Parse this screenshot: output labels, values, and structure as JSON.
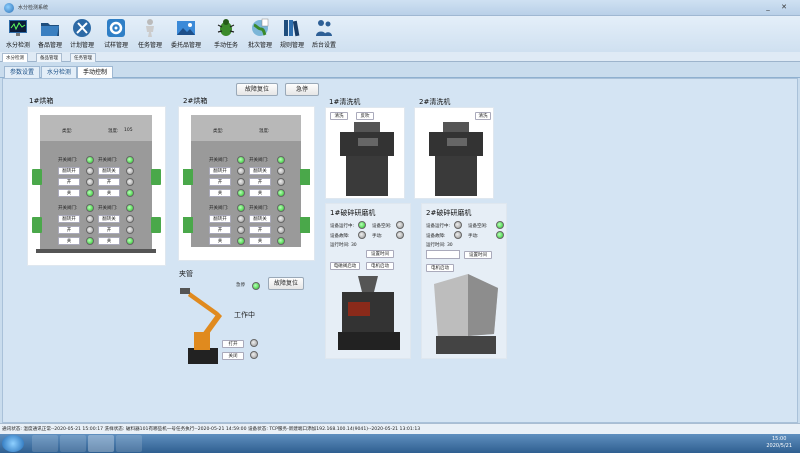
{
  "window": {
    "title": "水分检测系统",
    "minimize": "_",
    "close": "✕"
  },
  "toolbar": [
    {
      "label": "水分检测",
      "icon": "monitor-chart-icon"
    },
    {
      "label": "备品管理",
      "icon": "folder-icon"
    },
    {
      "label": "计划管理",
      "icon": "tools-icon"
    },
    {
      "label": "试样管理",
      "icon": "gear-icon"
    },
    {
      "label": "任务管理",
      "icon": "person-icon"
    },
    {
      "label": "委托品管理",
      "icon": "picture-icon"
    },
    {
      "label": "手动任务",
      "icon": "bug-icon"
    },
    {
      "label": "批次管理",
      "icon": "globe-icon"
    },
    {
      "label": "规则管理",
      "icon": "books-icon"
    },
    {
      "label": "后台设置",
      "icon": "users-icon"
    }
  ],
  "subtabs": [
    "水分检测",
    "备品管理",
    "任务管理"
  ],
  "tabs": [
    "参数设置",
    "水分检测",
    "手动控制"
  ],
  "buttons": {
    "fault_reset": "故障复位",
    "standby": "急停"
  },
  "oven1": {
    "title": "1#烘箱",
    "type_label": "类型:",
    "temp_label": "温度:",
    "temp_value": "105"
  },
  "oven2": {
    "title": "2#烘箱",
    "type_label": "类型:",
    "temp_label": "温度:",
    "temp_value": ""
  },
  "oven_ctrl": {
    "row_label": "开关阀门:",
    "left_btn": "翻转开",
    "right_btn": "翻转关",
    "open": "开",
    "close": "关"
  },
  "washer1": {
    "title": "1#清洗机",
    "btn1": "清洗",
    "btn2": "反吹"
  },
  "washer2": {
    "title": "2#清洗机",
    "btn1": "清洗"
  },
  "grinder1": {
    "title": "1#破碎研磨机",
    "l1": "设备运行中:",
    "l2": "设备空闲:",
    "l3": "设备故障:",
    "l4": "手动:",
    "runtime": "运行时间: 30",
    "b1": "设置时间",
    "b2": "电磁阀启动",
    "b3": "电机启动"
  },
  "grinder2": {
    "title": "2#破碎研磨机",
    "l1": "设备运行中:",
    "l2": "设备空闲:",
    "l3": "设备故障:",
    "l4": "手动:",
    "runtime": "运行时间: 30",
    "b1": "设置时间",
    "b2": "电机启动"
  },
  "gripper": {
    "title": "夹管",
    "status_label": "急停",
    "working": "工作中",
    "reset": "故障复位",
    "open": "打开",
    "close": "关闭"
  },
  "statusbar": "通讯状态: 温度通讯正常--2020-05-21 15:00:17  洗样状态: 破料器101有哪些机一号任务执行--2020-05-21 14:59:00  设备状态: TCP服务-新建端口添加192.168.100.14(9041)--2020-05-21 13:01:13",
  "clock": {
    "time": "15:00",
    "date": "2020/5/21"
  }
}
